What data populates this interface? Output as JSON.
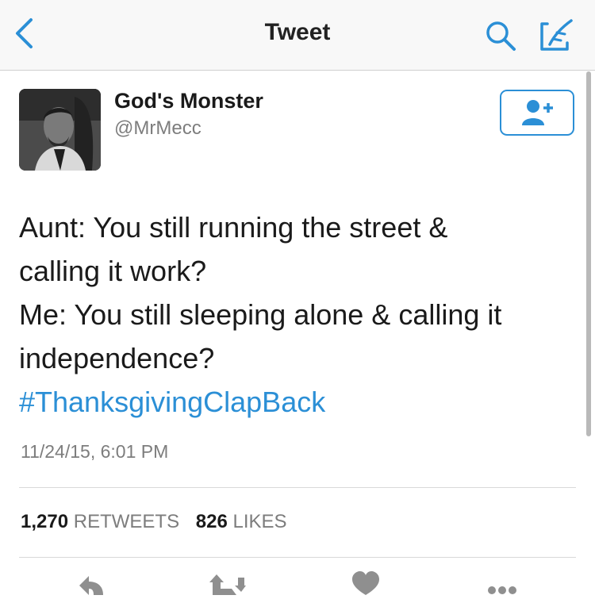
{
  "navbar": {
    "title": "Tweet",
    "accent_color": "#2b8fd6",
    "back_icon": "chevron-left-icon",
    "search_icon": "search-icon",
    "compose_icon": "compose-icon"
  },
  "tweet": {
    "display_name": "God's Monster",
    "handle": "@MrMecc",
    "follow_icon": "add-user-icon",
    "text_lines": [
      "Aunt: You still running the street &",
      "calling it work?",
      "Me: You still sleeping alone & calling it",
      "independence?"
    ],
    "hashtag": "#ThanksgivingClapBack",
    "timestamp": "11/24/15, 6:01 PM",
    "hashtag_color": "#2b8fd6"
  },
  "stats": {
    "retweets_count": "1,270",
    "retweets_label": "RETWEETS",
    "likes_count": "826",
    "likes_label": "LIKES"
  },
  "actions": {
    "reply_icon": "reply-icon",
    "retweet_icon": "retweet-icon",
    "like_icon": "heart-icon",
    "more_icon": "more-icon"
  }
}
